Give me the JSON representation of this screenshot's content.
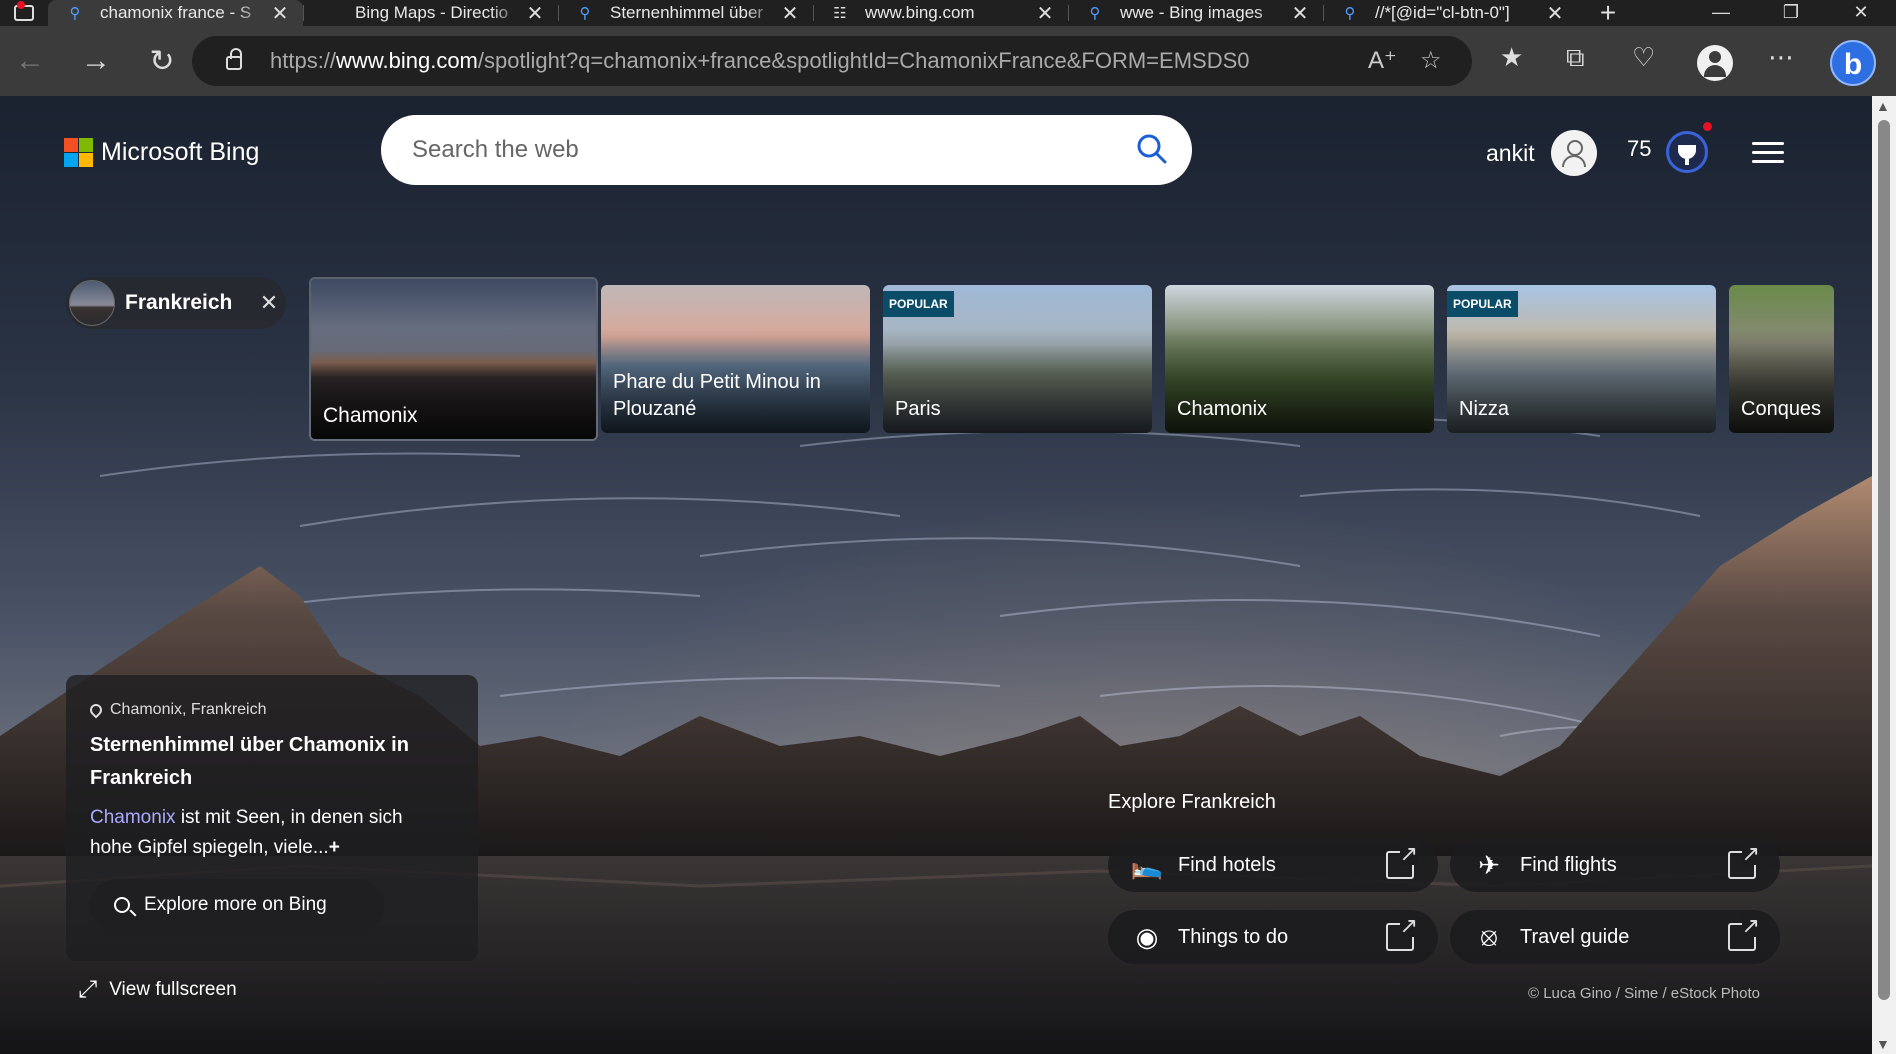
{
  "browser": {
    "tabs": [
      {
        "title": "chamonix france - S",
        "favicon": "search-icon",
        "active": true
      },
      {
        "title": "Bing Maps - Directio",
        "favicon": "",
        "active": false
      },
      {
        "title": "Sternenhimmel über",
        "favicon": "search-icon",
        "active": false
      },
      {
        "title": "www.bing.com",
        "favicon": "document-icon",
        "active": false
      },
      {
        "title": "wwe - Bing images",
        "favicon": "search-icon",
        "active": false
      },
      {
        "title": "//*[@id=\"cl-btn-0\"]",
        "favicon": "search-icon",
        "active": false
      }
    ],
    "url_prefix": "https://",
    "url_host": "www.bing.com",
    "url_path": "/spotlight?q=chamonix+france&spotlightId=ChamonixFrance&FORM=EMSDS0"
  },
  "header": {
    "logo_text": "Microsoft Bing",
    "search_placeholder": "Search the web",
    "user_name": "ankit",
    "points": "75"
  },
  "filter_chip": {
    "label": "Frankreich"
  },
  "carousel": [
    {
      "label": "Chamonix",
      "badge": "",
      "active": true
    },
    {
      "label": "Phare du Petit Minou in Plouzané",
      "badge": ""
    },
    {
      "label": "Paris",
      "badge": "POPULAR"
    },
    {
      "label": "Chamonix",
      "badge": ""
    },
    {
      "label": "Nizza",
      "badge": "POPULAR"
    },
    {
      "label": "Conques",
      "badge": ""
    }
  ],
  "info": {
    "location": "Chamonix, Frankreich",
    "title": "Sternenhimmel über Chamonix in Frankreich",
    "desc_link": "Chamonix",
    "desc_rest": " ist mit Seen, in denen sich hohe Gipfel spiegeln, viele...",
    "more": "+",
    "explore_label": "Explore more on Bing",
    "fullscreen_label": "View fullscreen"
  },
  "explore": {
    "title": "Explore Frankreich",
    "actions": [
      {
        "label": "Find hotels",
        "icon": "bed-icon"
      },
      {
        "label": "Find flights",
        "icon": "plane-icon"
      },
      {
        "label": "Things to do",
        "icon": "binoculars-icon"
      },
      {
        "label": "Travel guide",
        "icon": "compass-icon"
      }
    ]
  },
  "credit": "© Luca Gino / Sime / eStock Photo"
}
